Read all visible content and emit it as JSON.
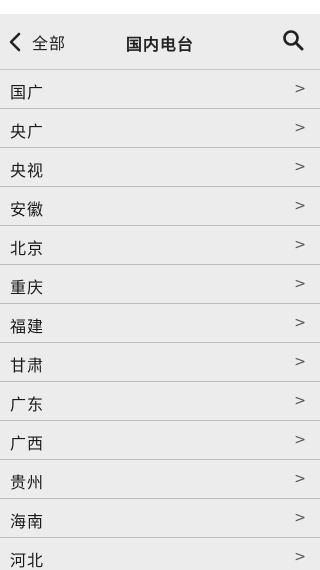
{
  "header": {
    "back_label": "全部",
    "title": "国内电台",
    "back_icon": "chevron-left-icon",
    "search_icon": "search-icon"
  },
  "stations": [
    {
      "label": "国广",
      "arrow": ">"
    },
    {
      "label": "央广",
      "arrow": ">"
    },
    {
      "label": "央视",
      "arrow": ">"
    },
    {
      "label": "安徽",
      "arrow": ">"
    },
    {
      "label": "北京",
      "arrow": ">"
    },
    {
      "label": "重庆",
      "arrow": ">"
    },
    {
      "label": "福建",
      "arrow": ">"
    },
    {
      "label": "甘肃",
      "arrow": ">"
    },
    {
      "label": "广东",
      "arrow": ">"
    },
    {
      "label": "广西",
      "arrow": ">"
    },
    {
      "label": "贵州",
      "arrow": ">"
    },
    {
      "label": "海南",
      "arrow": ">"
    },
    {
      "label": "河北",
      "arrow": ">"
    }
  ]
}
